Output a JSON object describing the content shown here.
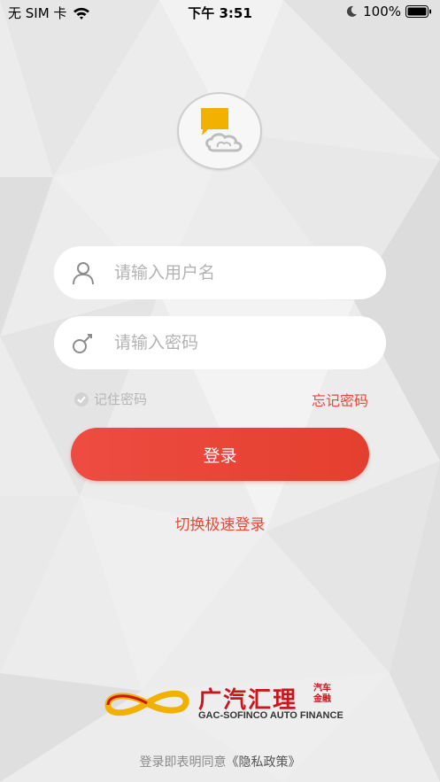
{
  "status_bar": {
    "carrier": "无 SIM 卡",
    "time": "下午 3:51",
    "battery": "100%"
  },
  "login": {
    "username_placeholder": "请输入用户名",
    "password_placeholder": "请输入密码",
    "remember_label": "记住密码",
    "forgot_label": "忘记密码",
    "login_button": "登录",
    "quick_login": "切换极速登录"
  },
  "brand": {
    "name_cn": "广汽汇理",
    "name_cn_small": "汽车金融",
    "name_en": "GAC-SOFINCO AUTO FINANCE"
  },
  "footer": {
    "policy_prefix": "登录即表明同意",
    "policy_link": "《隐私政策》"
  },
  "colors": {
    "accent": "#e5493a",
    "brand_red": "#c9171e",
    "brand_gold": "#f2b100"
  },
  "icons": [
    "wifi-icon",
    "moon-icon",
    "battery-icon",
    "user-icon",
    "key-icon",
    "check-icon"
  ]
}
